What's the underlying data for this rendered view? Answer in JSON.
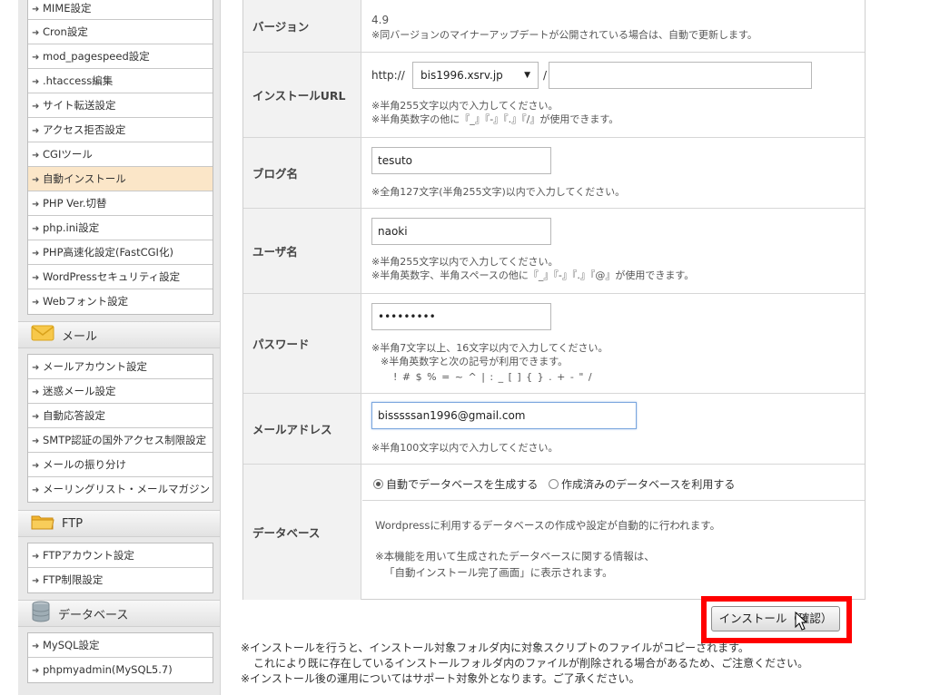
{
  "sidebar": {
    "server_items": [
      "MIME設定",
      "Cron設定",
      "mod_pagespeed設定",
      ".htaccess編集",
      "サイト転送設定",
      "アクセス拒否設定",
      "CGIツール",
      "自動インストール",
      "PHP Ver.切替",
      "php.ini設定",
      "PHP高速化設定(FastCGI化)",
      "WordPressセキュリティ設定",
      "Webフォント設定"
    ],
    "mail_header": "メール",
    "mail_items": [
      "メールアカウント設定",
      "迷惑メール設定",
      "自動応答設定",
      "SMTP認証の国外アクセス制限設定",
      "メールの振り分け",
      "メーリングリスト・メールマガジン"
    ],
    "ftp_header": "FTP",
    "ftp_items": [
      "FTPアカウント設定",
      "FTP制限設定"
    ],
    "db_header": "データベース",
    "db_items": [
      "MySQL設定",
      "phpmyadmin(MySQL5.7)"
    ]
  },
  "form": {
    "version": {
      "label": "バージョン",
      "value": "4.9",
      "note": "※同バージョンのマイナーアップデートが公開されている場合は、自動で更新します。"
    },
    "install_url": {
      "label": "インストールURL",
      "prefix": "http://",
      "domain": "bis1996.xsrv.jp",
      "separator": "/",
      "path": "",
      "note1": "※半角255文字以内で入力してください。",
      "note2": "※半角英数字の他に『_』『-』『.』『/』が使用できます。"
    },
    "blog_name": {
      "label": "ブログ名",
      "value": "tesuto",
      "note": "※全角127文字(半角255文字)以内で入力してください。"
    },
    "username": {
      "label": "ユーザ名",
      "value": "naoki",
      "note1": "※半角255文字以内で入力してください。",
      "note2": "※半角英数字、半角スペースの他に『_』『-』『.』『@』が使用できます。"
    },
    "password": {
      "label": "パスワード",
      "value": "•••••••••",
      "note1": "※半角7文字以上、16文字以内で入力してください。",
      "note2": "※半角英数字と次の記号が利用できます。",
      "note3": "! # $ % = ~ ^ | : _ [ ] { } . + - \" /"
    },
    "email": {
      "label": "メールアドレス",
      "value": "bisssssan1996@gmail.com",
      "note": "※半角100文字以内で入力してください。"
    },
    "database": {
      "label": "データベース",
      "option_auto": "自動でデータベースを生成する",
      "option_existing": "作成済みのデータベースを利用する",
      "desc1": "Wordpressに利用するデータベースの作成や設定が自動的に行われます。",
      "desc2": "※本機能を用いて生成されたデータベースに関する情報は、",
      "desc3": "「自動インストール完了画面」に表示されます。"
    }
  },
  "install_button": "インストール（確認）",
  "footer": {
    "line1": "※インストールを行うと、インストール対象フォルダ内に対象スクリプトのファイルがコピーされます。",
    "line2": "これにより既に存在しているインストールフォルダ内のファイルが削除される場合があるため、ご注意ください。",
    "line3": "※インストール後の運用についてはサポート対象外となります。ご了承ください。"
  },
  "colors": {
    "active_menu_bg": "#fbe6c8",
    "highlight": "#ff0000"
  }
}
